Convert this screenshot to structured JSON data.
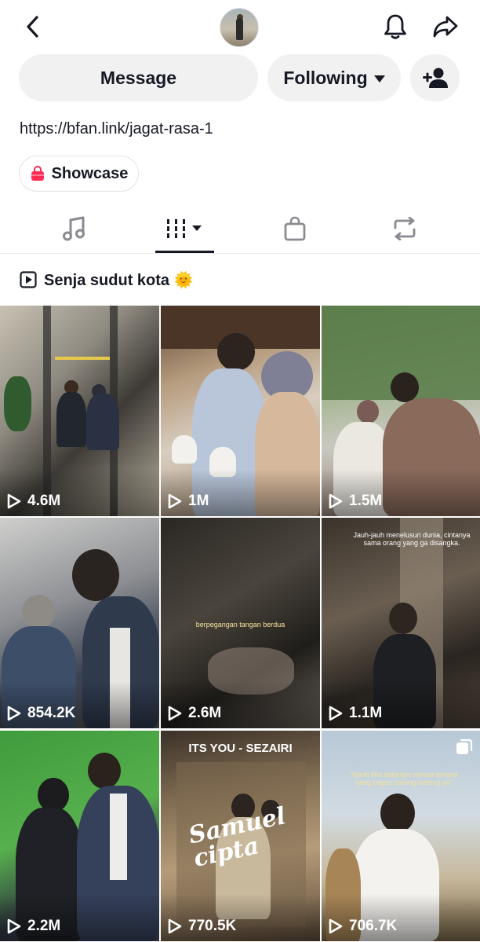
{
  "header": {
    "back_icon": "chevron-left-icon",
    "avatar_icon": "profile-avatar",
    "bell_icon": "bell-icon",
    "share_icon": "share-arrow-icon"
  },
  "actions": {
    "message_label": "Message",
    "following_label": "Following",
    "add_friend_icon": "add-user-icon"
  },
  "bio": {
    "link": "https://bfan.link/jagat-rasa-1"
  },
  "showcase": {
    "label": "Showcase",
    "icon": "shopping-bag-icon"
  },
  "tabs": [
    {
      "name": "music",
      "icon": "music-note-icon"
    },
    {
      "name": "videos",
      "icon": "grid-icon",
      "selected": true
    },
    {
      "name": "shop",
      "icon": "shopping-bag-icon"
    },
    {
      "name": "reposts",
      "icon": "repost-icon"
    }
  ],
  "playlist": {
    "label": "Senja sudut kota 🌞",
    "icon": "playlist-play-icon"
  },
  "videos": [
    {
      "views": "4.6M"
    },
    {
      "views": "1M"
    },
    {
      "views": "1.5M"
    },
    {
      "views": "854.2K"
    },
    {
      "views": "2.6M",
      "caption": "berpegangan tangan berdua"
    },
    {
      "views": "1.1M",
      "caption": "Jauh-jauh menelusuri dunia, cintanya sama orang yang ga disangka."
    },
    {
      "views": "2.2M"
    },
    {
      "views": "770.5K",
      "title": "ITS YOU - SEZAIRI",
      "logo": "Samuel cipta"
    },
    {
      "views": "706.7K",
      "caption": "\"Nanti kita datangin semua tempat yang bagus bareng-bareng ya\""
    }
  ],
  "colors": {
    "text": "#161823",
    "button_bg": "#f1f1f2",
    "showcase_bag": "#fe2c55"
  }
}
